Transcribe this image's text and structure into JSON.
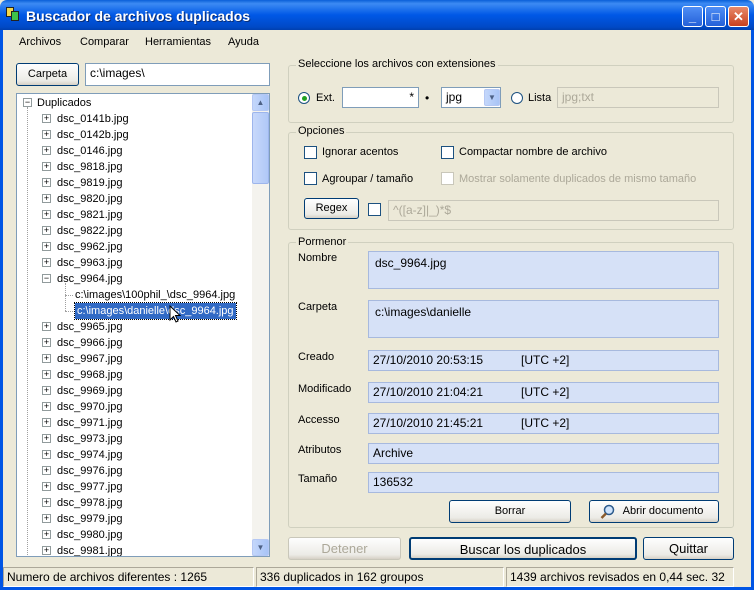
{
  "window": {
    "title": "Buscador de archivos duplicados"
  },
  "menu": [
    "Archivos",
    "Comparar",
    "Herramientas",
    "Ayuda"
  ],
  "folder": {
    "button": "Carpeta",
    "path": "c:\\images\\"
  },
  "tree": {
    "root": "Duplicados",
    "items_before": [
      "dsc_0141b.jpg",
      "dsc_0142b.jpg",
      "dsc_0146.jpg",
      "dsc_9818.jpg",
      "dsc_9819.jpg",
      "dsc_9820.jpg",
      "dsc_9821.jpg",
      "dsc_9822.jpg",
      "dsc_9962.jpg",
      "dsc_9963.jpg"
    ],
    "expanded": "dsc_9964.jpg",
    "children": [
      "c:\\images\\100phil_\\dsc_9964.jpg",
      "c:\\images\\danielle\\dsc_9964.jpg"
    ],
    "items_after": [
      "dsc_9965.jpg",
      "dsc_9966.jpg",
      "dsc_9967.jpg",
      "dsc_9968.jpg",
      "dsc_9969.jpg",
      "dsc_9970.jpg",
      "dsc_9971.jpg",
      "dsc_9973.jpg",
      "dsc_9974.jpg",
      "dsc_9976.jpg",
      "dsc_9977.jpg",
      "dsc_9978.jpg",
      "dsc_9979.jpg",
      "dsc_9980.jpg",
      "dsc_9981.jpg"
    ]
  },
  "extensions": {
    "group_label": "Seleccione los archivos con extensiones",
    "ext_label": "Ext.",
    "ext_value": "*",
    "dot": "•",
    "combo_value": "jpg",
    "list_label": "Lista",
    "list_value": "jpg;txt"
  },
  "options": {
    "group_label": "Opciones",
    "ignore_accents": "Ignorar acentos",
    "compact_name": "Compactar nombre de archivo",
    "group_size": "Agroupar / tamaño",
    "same_size_only": "Mostrar solamente duplicados de mismo tamaño",
    "regex_button": "Regex",
    "regex_value": "^([a-z]|_)*$"
  },
  "details": {
    "group_label": "Pormenor",
    "name_label": "Nombre",
    "name": "dsc_9964.jpg",
    "folder_label": "Carpeta",
    "folder": "c:\\images\\danielle",
    "created_label": "Creado",
    "created": "27/10/2010 20:53:15",
    "created_tz": "[UTC +2]",
    "modified_label": "Modificado",
    "modified": "27/10/2010 21:04:21",
    "modified_tz": "[UTC +2]",
    "accessed_label": "Accesso",
    "accessed": "27/10/2010 21:45:21",
    "accessed_tz": "[UTC +2]",
    "attributes_label": "Atributos",
    "attributes": "Archive",
    "size_label": "Tamaño",
    "size": "136532",
    "delete_button": "Borrar",
    "open_button": "Abrir documento"
  },
  "actions": {
    "stop": "Detener",
    "search": "Buscar los duplicados",
    "quit": "Quittar"
  },
  "status": {
    "distinct": "Numero de archivos diferentes : 1265",
    "duplicates": "336 duplicados in 162 groupos",
    "scanned": "1439 archivos revisados en 0,44 sec. 32"
  }
}
